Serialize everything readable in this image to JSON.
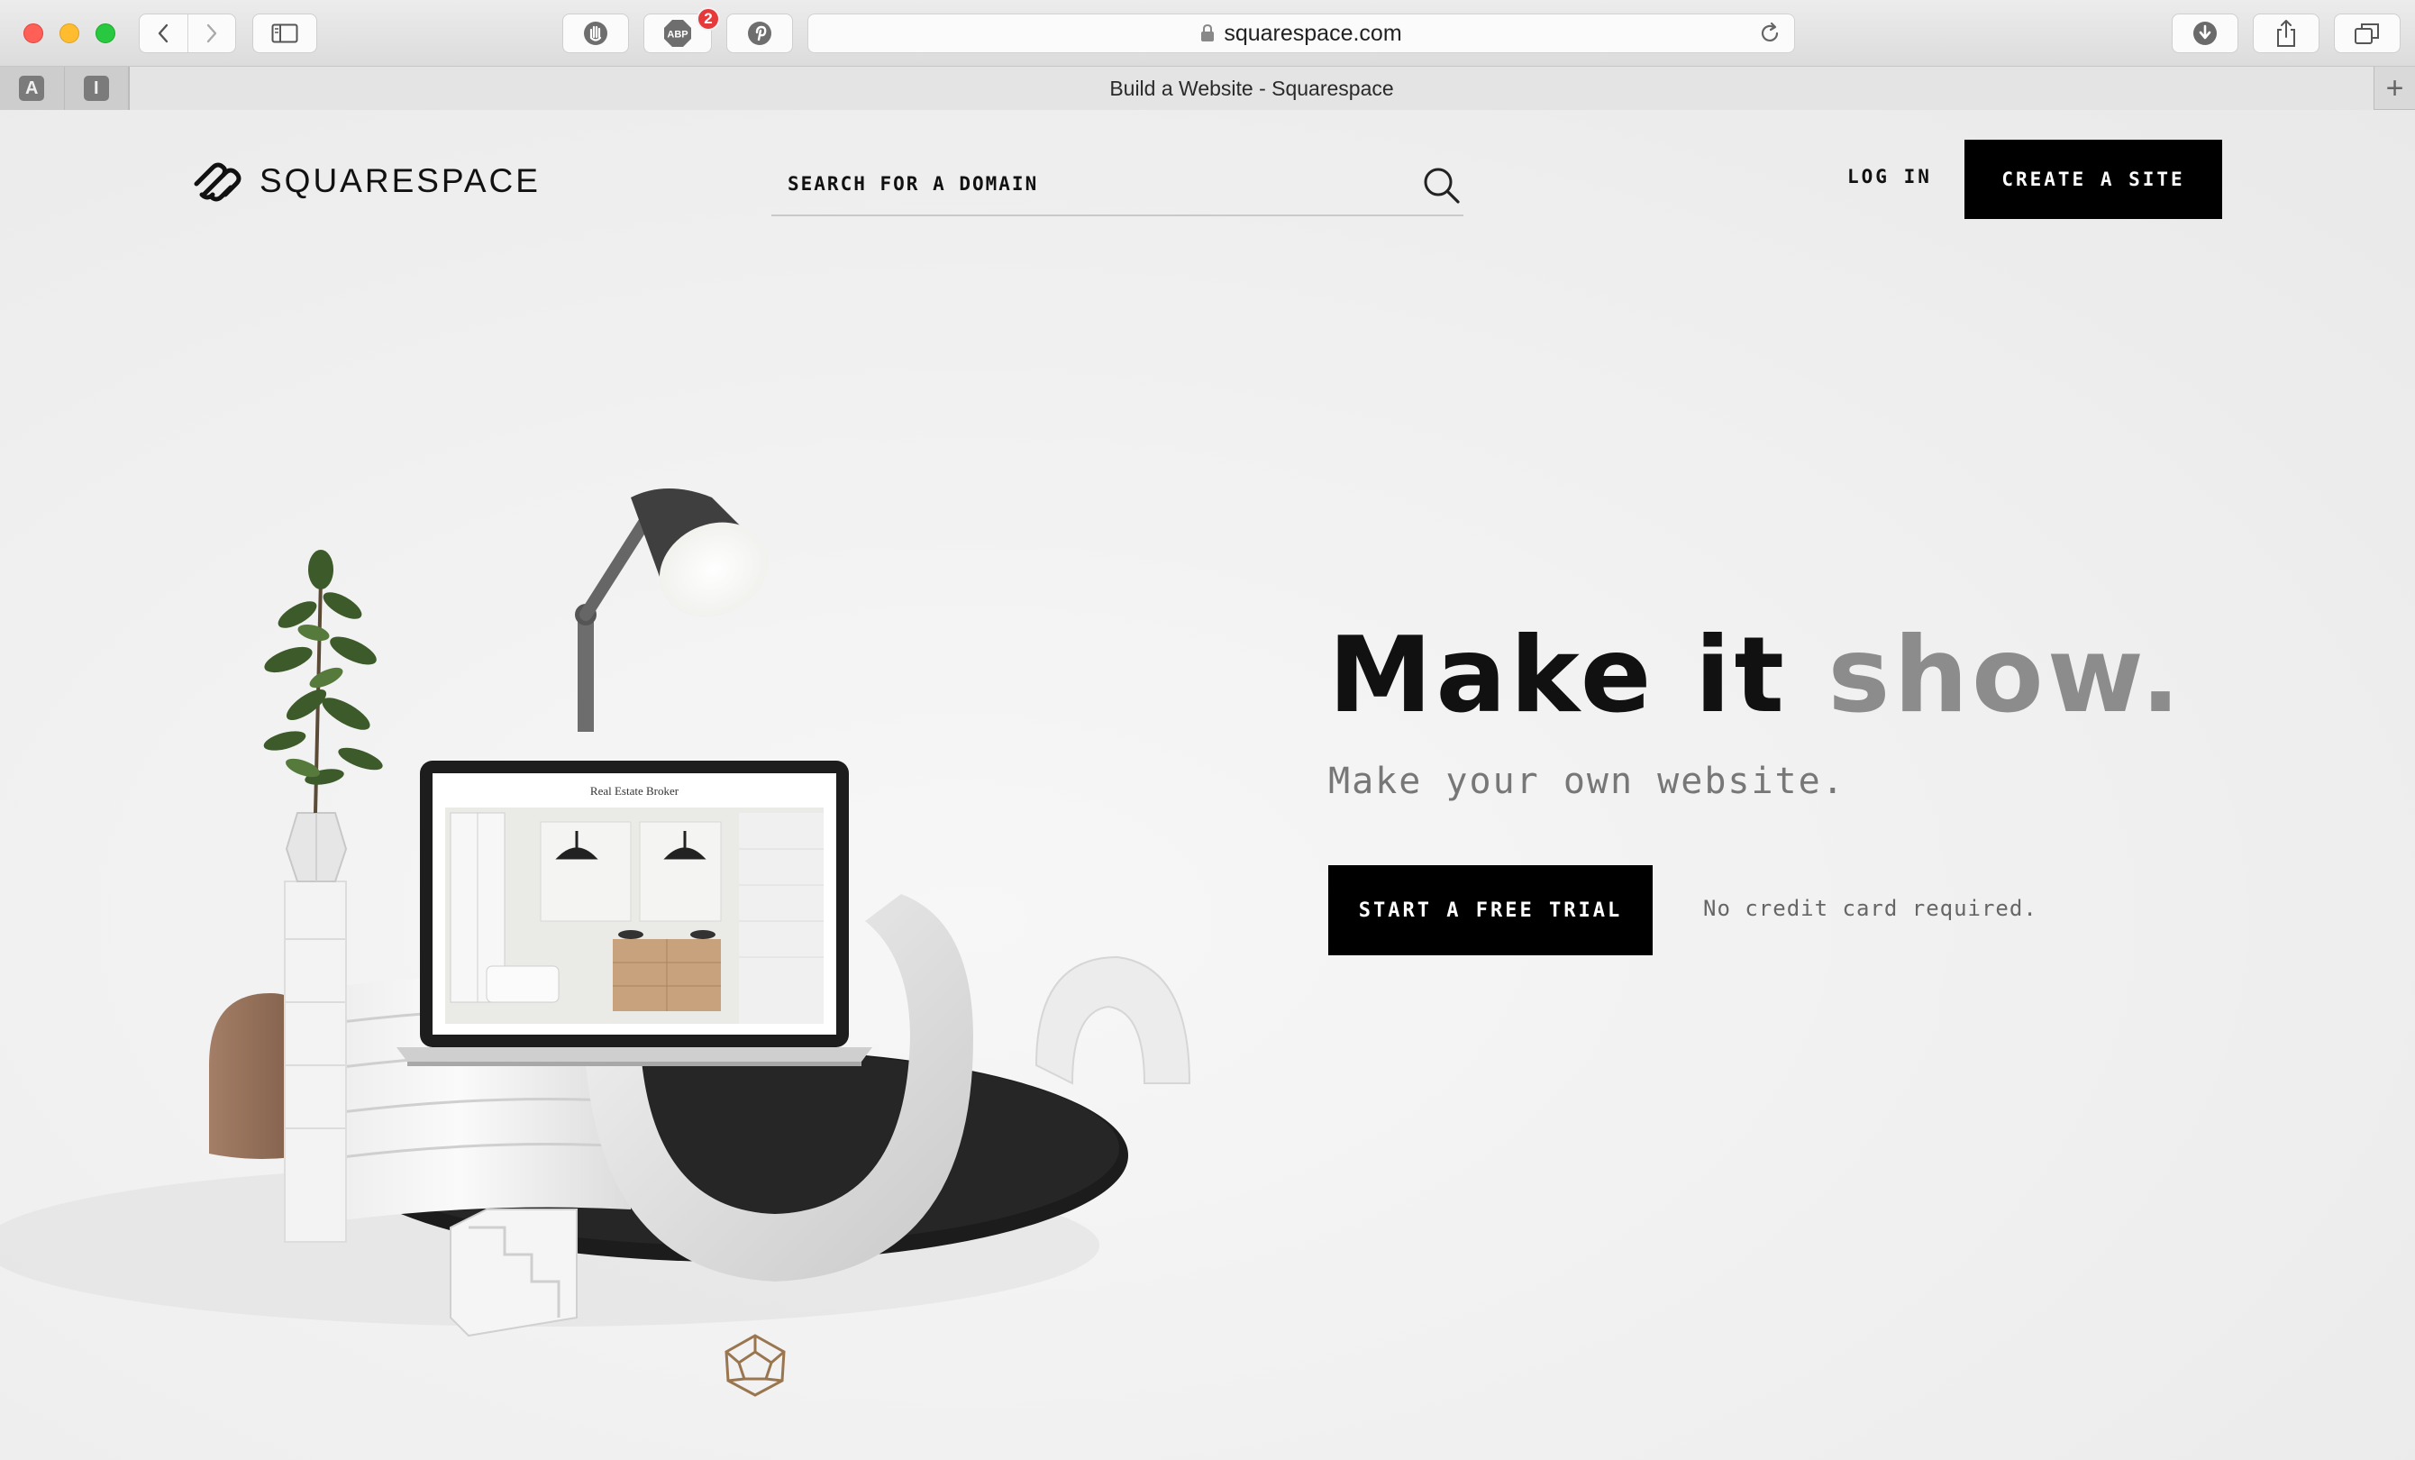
{
  "browser": {
    "url": "squarespace.com",
    "tab_title": "Build a Website - Squarespace",
    "abp_badge": "2",
    "pinned_tabs": [
      "A",
      "I"
    ],
    "new_tab_label": "+"
  },
  "header": {
    "brand_name": "SQUARESPACE",
    "search_placeholder": "SEARCH FOR A DOMAIN",
    "login_label": "LOG IN",
    "create_label": "CREATE A SITE"
  },
  "hero": {
    "headline_main": "Make it ",
    "headline_accent": "show.",
    "subheadline": "Make your own website.",
    "cta_label": "START A FREE TRIAL",
    "cta_note": "No credit card required.",
    "laptop_screen_title": "Real Estate Broker"
  },
  "colors": {
    "accent_gray": "#8c8c8c",
    "button_bg": "#000000",
    "badge_red": "#e5393a"
  }
}
